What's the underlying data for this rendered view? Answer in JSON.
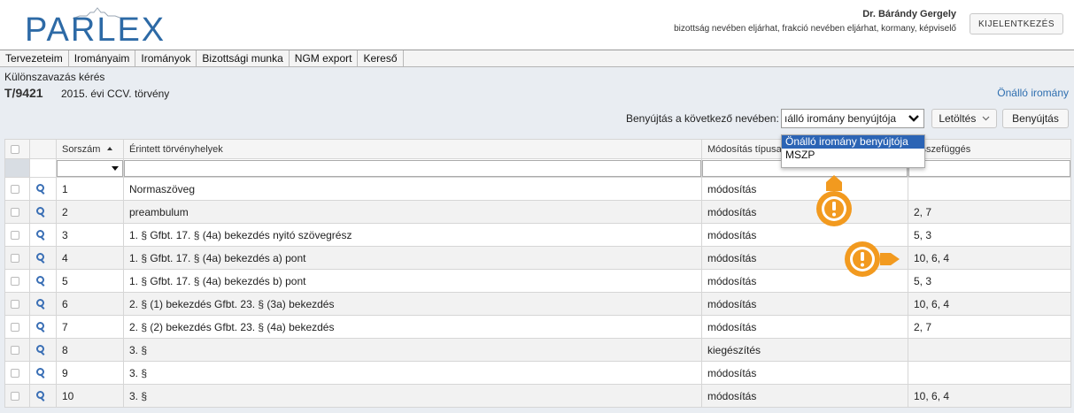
{
  "header": {
    "logo_text": "PARLEX",
    "user_name": "Dr. Bárándy Gergely",
    "user_roles": "bizottság nevében eljárhat, frakció nevében eljárhat, kormany, képviselő",
    "logout_label": "KIJELENTKEZÉS"
  },
  "menu": {
    "items": [
      "Tervezeteim",
      "Irományaim",
      "Irományok",
      "Bizottsági munka",
      "NGM export",
      "Kereső"
    ]
  },
  "page": {
    "breadcrumb": "Különszavazás kérés",
    "doc_id": "T/9421",
    "doc_title": "2015. évi CCV. törvény",
    "own_link": "Önálló iromány",
    "submit_on_behalf_label": "Benyújtás a következő nevében:",
    "select_value": "ıálló iromány benyújtója",
    "download_label": "Letöltés",
    "submit_label": "Benyújtás"
  },
  "dropdown": {
    "options": [
      "Önálló iromány benyújtója",
      "MSZP"
    ],
    "selected_index": 0
  },
  "table": {
    "headers": {
      "number": "Sorszám",
      "affected": "Érintett törvényhelyek",
      "mod_type": "Módosítás típusa",
      "relation": "Összefüggés"
    },
    "rows": [
      {
        "n": "1",
        "affected": "Normaszöveg",
        "type": "módosítás",
        "rel": ""
      },
      {
        "n": "2",
        "affected": "preambulum",
        "type": "módosítás",
        "rel": "2, 7"
      },
      {
        "n": "3",
        "affected": "1. § Gfbt. 17. § (4a) bekezdés nyitó szövegrész",
        "type": "módosítás",
        "rel": "5, 3"
      },
      {
        "n": "4",
        "affected": "1. § Gfbt. 17. § (4a) bekezdés a) pont",
        "type": "módosítás",
        "rel": "10, 6, 4"
      },
      {
        "n": "5",
        "affected": "1. § Gfbt. 17. § (4a) bekezdés b) pont",
        "type": "módosítás",
        "rel": "5, 3"
      },
      {
        "n": "6",
        "affected": "2. § (1) bekezdés Gfbt. 23. § (3a) bekezdés",
        "type": "módosítás",
        "rel": "10, 6, 4"
      },
      {
        "n": "7",
        "affected": "2. § (2) bekezdés Gfbt. 23. § (4a) bekezdés",
        "type": "módosítás",
        "rel": "2, 7"
      },
      {
        "n": "8",
        "affected": "3. §",
        "type": "kiegészítés",
        "rel": ""
      },
      {
        "n": "9",
        "affected": "3. §",
        "type": "módosítás",
        "rel": ""
      },
      {
        "n": "10",
        "affected": "3. §",
        "type": "módosítás",
        "rel": "10, 6, 4"
      }
    ]
  },
  "colors": {
    "brand_blue": "#2d6aa6",
    "link_blue": "#2f6fb0",
    "selected_option": "#2b64b5",
    "callout_orange": "#f29a1f",
    "content_bg": "#e9edf2"
  },
  "icons": {
    "row_view": "magnifier-icon",
    "callout": "warning-icon",
    "select_arrow": "chevron-down-icon"
  }
}
